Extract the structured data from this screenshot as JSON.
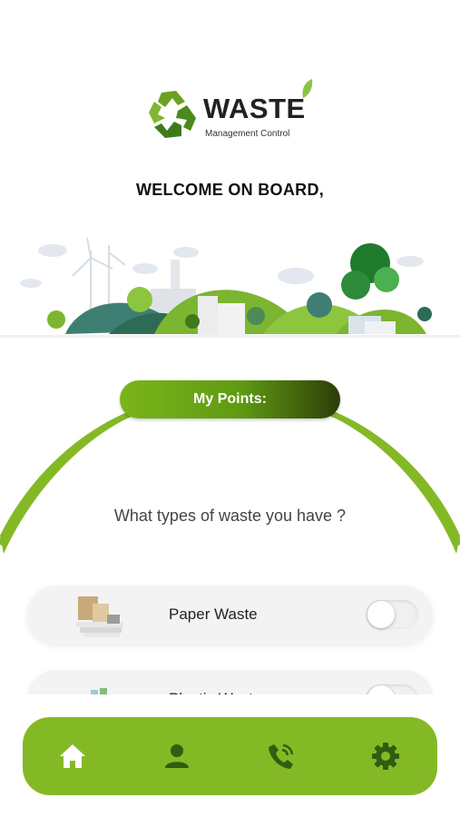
{
  "logo": {
    "word": "WASTE",
    "subtitle": "Management Control"
  },
  "welcome_text": "WELCOME ON BOARD,",
  "points_button_label": "My Points:",
  "question_text": "What types of waste you have ?",
  "waste_types": [
    {
      "label": "Paper Waste",
      "icon": "paper-waste-icon",
      "enabled": false
    },
    {
      "label": "Plastic Waste",
      "icon": "plastic-waste-icon",
      "enabled": false
    }
  ],
  "nav": [
    {
      "icon": "home-icon"
    },
    {
      "icon": "profile-icon"
    },
    {
      "icon": "phone-icon"
    },
    {
      "icon": "settings-icon"
    }
  ],
  "colors": {
    "accent": "#84b926",
    "accent_dark": "#2c3d08",
    "text": "#222222"
  }
}
